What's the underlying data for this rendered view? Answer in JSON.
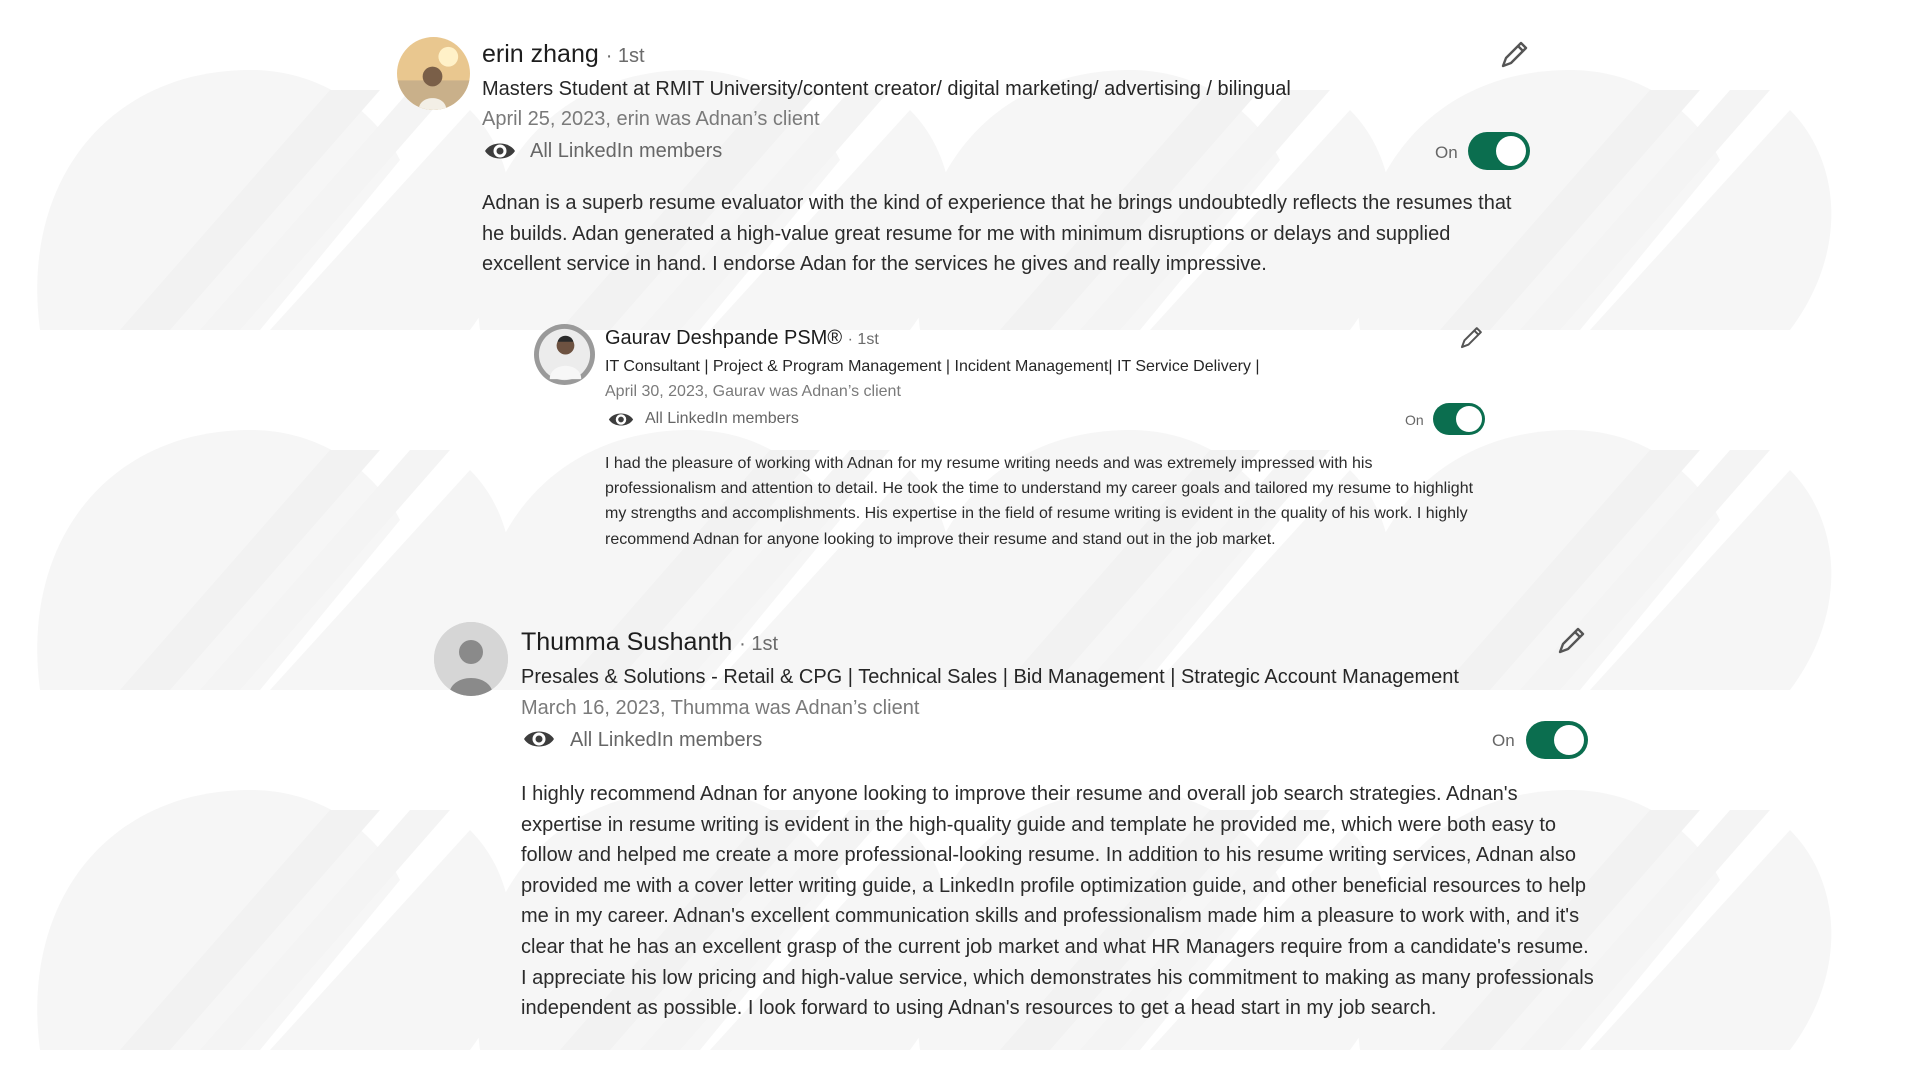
{
  "colors": {
    "toggle_on": "#0b6e4f",
    "text_primary": "#1d1d1d",
    "text_secondary": "#7a7a7a",
    "watermark": "#f5f5f5"
  },
  "icons": {
    "visibility": "eye-icon",
    "edit": "pencil-icon",
    "avatar_placeholder": "person-icon"
  },
  "recommendations": [
    {
      "name": "erin zhang",
      "degree": "· 1st",
      "headline": "Masters Student at RMIT University/content creator/ digital marketing/ advertising / bilingual",
      "date_relation": "April 25, 2023, erin was Adnan’s client",
      "visibility": "All LinkedIn members",
      "toggle_label": "On",
      "toggle_on": true,
      "text": "Adnan is a superb resume evaluator with the kind of experience that he brings undoubtedly reflects the resumes that he builds. Adan generated a high-value great resume for me with minimum disruptions or delays and supplied excellent service in hand. I endorse Adan for the services he gives and really impressive."
    },
    {
      "name": "Gaurav Deshpande PSM®",
      "degree": "· 1st",
      "headline": "IT Consultant | Project & Program Management | Incident Management| IT Service Delivery |",
      "date_relation": "April 30, 2023, Gaurav was Adnan’s client",
      "visibility": "All LinkedIn members",
      "toggle_label": "On",
      "toggle_on": true,
      "text": "I had the pleasure of working with Adnan for my resume writing needs and was extremely impressed with his professionalism and attention to detail. He took the time to understand my career goals and tailored my resume to highlight my strengths and accomplishments. His expertise in the field of resume writing is evident in the quality of his work. I highly recommend Adnan for anyone looking to improve their resume and stand out in the job market."
    },
    {
      "name": "Thumma Sushanth",
      "degree": "· 1st",
      "headline": "Presales & Solutions - Retail & CPG | Technical Sales | Bid Management | Strategic Account Management",
      "date_relation": "March 16, 2023, Thumma was Adnan’s client",
      "visibility": "All LinkedIn members",
      "toggle_label": "On",
      "toggle_on": true,
      "text": "I highly recommend Adnan for anyone looking to improve their resume and overall job search strategies. Adnan's expertise in resume writing is evident in the high-quality guide and template he provided me, which were both easy to follow and helped me create a more professional-looking resume. In addition to his resume writing services, Adnan also provided me with a cover letter writing guide, a LinkedIn profile optimization guide, and other beneficial resources to help me in my career. Adnan's excellent communication skills and professionalism made him a pleasure to work with, and it's clear that he has an excellent grasp of the current job market and what HR Managers require from a candidate's resume. I appreciate his low pricing and high-value service, which demonstrates his commitment to making as many professionals independent as possible. I look forward to using Adnan's resources to get a head start in my job search."
    }
  ]
}
